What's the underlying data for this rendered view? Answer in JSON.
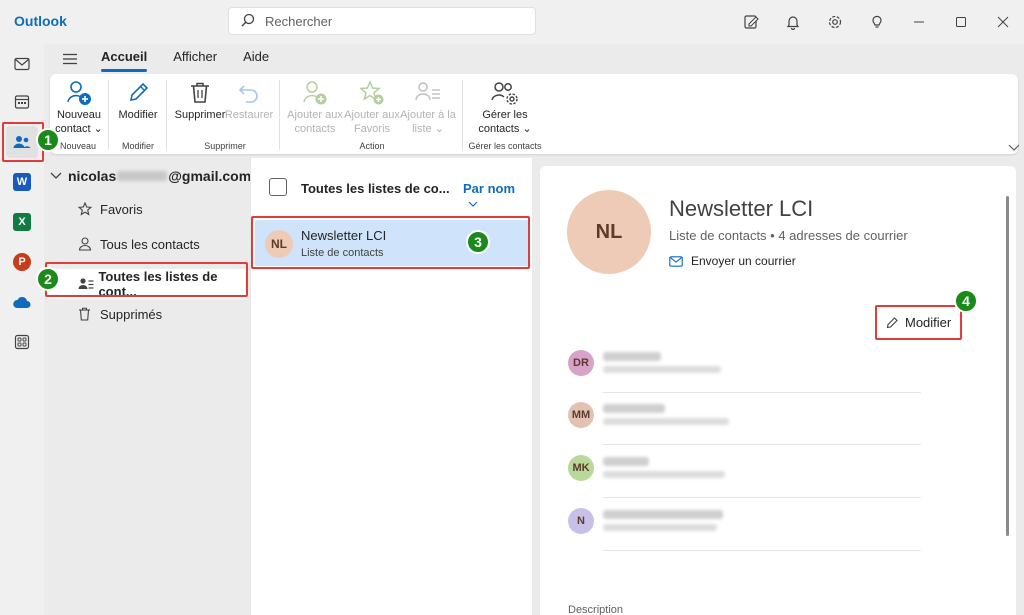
{
  "titlebar": {
    "app_title": "Outlook",
    "search_placeholder": "Rechercher",
    "icons": [
      "compose-note-icon",
      "bell-icon",
      "gear-icon",
      "lightbulb-icon",
      "minimize-icon",
      "maximize-icon",
      "close-icon"
    ]
  },
  "rail": {
    "items": [
      {
        "name": "mail",
        "icon": "mail-icon"
      },
      {
        "name": "calendar",
        "icon": "calendar-icon"
      },
      {
        "name": "people",
        "icon": "people-icon",
        "active": true
      },
      {
        "name": "word",
        "badge": "W",
        "color": "#185abd"
      },
      {
        "name": "excel",
        "badge": "X",
        "color": "#107c41"
      },
      {
        "name": "powerpoint",
        "badge": "P",
        "color": "#c43e1c"
      },
      {
        "name": "onedrive",
        "icon": "cloud-icon"
      },
      {
        "name": "apps",
        "icon": "apps-icon"
      }
    ]
  },
  "ribbon": {
    "tabs": [
      "Accueil",
      "Afficher",
      "Aide"
    ],
    "buttons": {
      "new_contact": [
        "Nouveau",
        "contact"
      ],
      "modify": "Modifier",
      "delete": "Supprimer",
      "restore": "Restaurer",
      "add_to_contacts": [
        "Ajouter aux",
        "contacts"
      ],
      "add_to_favorites": [
        "Ajouter aux",
        "Favoris"
      ],
      "add_to_list": [
        "Ajouter à la",
        "liste"
      ],
      "manage_contacts": [
        "Gérer les",
        "contacts"
      ]
    },
    "groups": {
      "new": "Nouveau",
      "modify": "Modifier",
      "delete": "Supprimer",
      "action": "Action",
      "manage": "Gérer les contacts"
    }
  },
  "folders": {
    "account_prefix": "nicolas",
    "account_suffix": "@gmail.com",
    "items": [
      "Favoris",
      "Tous les contacts",
      "Toutes les listes de cont...",
      "Supprimés"
    ]
  },
  "list": {
    "header_title": "Toutes les listes de co...",
    "sort_label": "Par nom",
    "row": {
      "initials": "NL",
      "name": "Newsletter LCI",
      "subtitle": "Liste de contacts"
    }
  },
  "detail": {
    "initials": "NL",
    "title": "Newsletter LCI",
    "subtitle": "Liste de contacts • 4 adresses de courrier",
    "send_mail": "Envoyer un courrier",
    "modify": "Modifier",
    "members": [
      {
        "initials": "DR",
        "color": "#d9a3c9"
      },
      {
        "initials": "MM",
        "color": "#e2c3b3"
      },
      {
        "initials": "MK",
        "color": "#b9d89a"
      },
      {
        "initials": "N",
        "color": "#c9c0ea"
      }
    ],
    "description_label": "Description"
  },
  "annotations": {
    "colors": {
      "callout": "#e03c3c",
      "marker": "#1a8a1a"
    },
    "markers": [
      "1",
      "2",
      "3",
      "4"
    ]
  }
}
